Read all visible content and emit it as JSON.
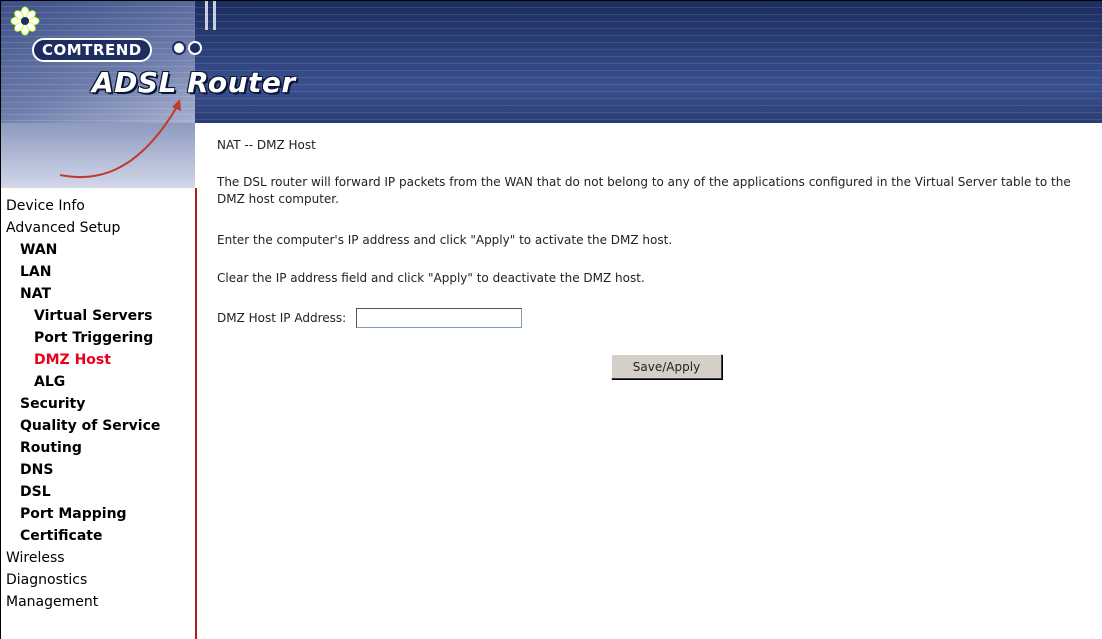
{
  "header": {
    "brand": "COMTREND",
    "product": "ADSL Router"
  },
  "sidebar": {
    "items": [
      {
        "label": "Device Info",
        "level": 0
      },
      {
        "label": "Advanced Setup",
        "level": 0
      },
      {
        "label": "WAN",
        "level": 1
      },
      {
        "label": "LAN",
        "level": 1
      },
      {
        "label": "NAT",
        "level": 1
      },
      {
        "label": "Virtual Servers",
        "level": 2
      },
      {
        "label": "Port Triggering",
        "level": 2
      },
      {
        "label": "DMZ Host",
        "level": 2,
        "active": true
      },
      {
        "label": "ALG",
        "level": 2
      },
      {
        "label": "Security",
        "level": 1
      },
      {
        "label": "Quality of Service",
        "level": 1
      },
      {
        "label": "Routing",
        "level": 1
      },
      {
        "label": "DNS",
        "level": 1
      },
      {
        "label": "DSL",
        "level": 1
      },
      {
        "label": "Port Mapping",
        "level": 1
      },
      {
        "label": "Certificate",
        "level": 1
      },
      {
        "label": "Wireless",
        "level": 0
      },
      {
        "label": "Diagnostics",
        "level": 0
      },
      {
        "label": "Management",
        "level": 0
      }
    ]
  },
  "main": {
    "title": "NAT -- DMZ Host",
    "intro": "The DSL router will forward IP packets from the WAN that do not belong to any of the applications configured in the Virtual Server table to the DMZ host computer.",
    "activate_hint": "Enter the computer's IP address and click \"Apply\" to activate the DMZ host.",
    "deactivate_hint": "Clear the IP address field and click \"Apply\" to deactivate the DMZ host.",
    "dmz_field": {
      "label": "DMZ Host IP Address:",
      "value": ""
    },
    "apply_button": "Save/Apply"
  },
  "colors": {
    "banner": "#2b3f78",
    "sidebar_border": "#b31b1b",
    "active_nav": "#e8001c"
  }
}
